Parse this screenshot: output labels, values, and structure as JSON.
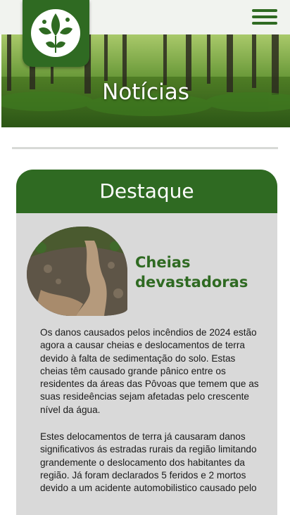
{
  "header": {
    "logo": "leaf-bird-emblem-logo",
    "menu_icon": "hamburger-menu-icon",
    "colors": {
      "brand_green": "#2f6a22",
      "topbar": "#f1f3ef"
    }
  },
  "hero": {
    "title": "Notícias",
    "image": "forest-background"
  },
  "featured": {
    "heading": "Destaque",
    "card_background": "#d9d9d9",
    "article": {
      "image": "muddy-stream-photo",
      "title": "Cheias devastadoras",
      "paragraphs": [
        "Os danos causados pelos incêndios de 2024 estão agora a causar cheias e deslocamentos de terra devido à falta de sedimentação do solo. Estas cheias têm causado grande pânico entre os residentes da áreas das Pôvoas que temem que as suas resideências sejam afetadas pelo crescente nível da água.",
        "Estes delocamentos de terra já causaram danos significativos ás estradas rurais da região limitando grandemente o deslocamento dos habitantes da região. Já foram declarados 5 feridos e 2 mortos devido a um  acidente automobilistico causado pelo"
      ]
    }
  }
}
